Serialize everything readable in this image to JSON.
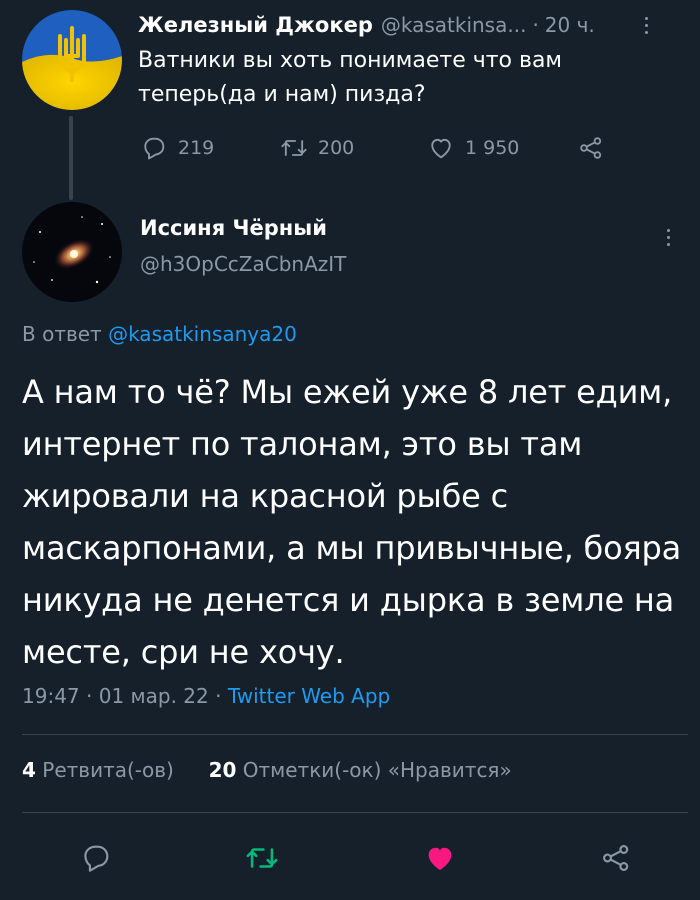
{
  "parent_tweet": {
    "author_name": "Железный Джокер",
    "handle": "@kasatkinsa...",
    "separator": "·",
    "time": "20 ч.",
    "text": "Ватники вы хоть понимаете что вам теперь(да и нам) пизда?",
    "replies": "219",
    "retweets": "200",
    "likes": "1 950"
  },
  "main_tweet": {
    "author_name": "Иссиня Чёрный",
    "handle": "@h3OpCcZaCbnAzIT",
    "reply_label": "В ответ",
    "reply_mention": "@kasatkinsanya20",
    "text": "А нам то чё? Мы ежей уже 8 лет едим, интернет по талонам, это вы там жировали на красной рыбе с маскарпонами, а мы привычные, бояра никуда не денется и дырка в земле на месте, сри не хочу.",
    "time": "19:47",
    "date": "01 мар. 22",
    "separator": "·",
    "source": "Twitter Web App",
    "retweet_count": "4",
    "retweet_label": "Ретвита(-ов)",
    "like_count": "20",
    "like_label": "Отметки(-ок) «Нравится»"
  },
  "colors": {
    "background": "#15202b",
    "muted": "#8b98a5",
    "accent": "#1d9bf0",
    "retweet_active": "#00ba7c",
    "like_active": "#f91880"
  },
  "icons": {
    "reply": "reply-icon",
    "retweet": "retweet-icon",
    "like": "heart-icon",
    "share": "share-icon",
    "more": "more-icon"
  }
}
